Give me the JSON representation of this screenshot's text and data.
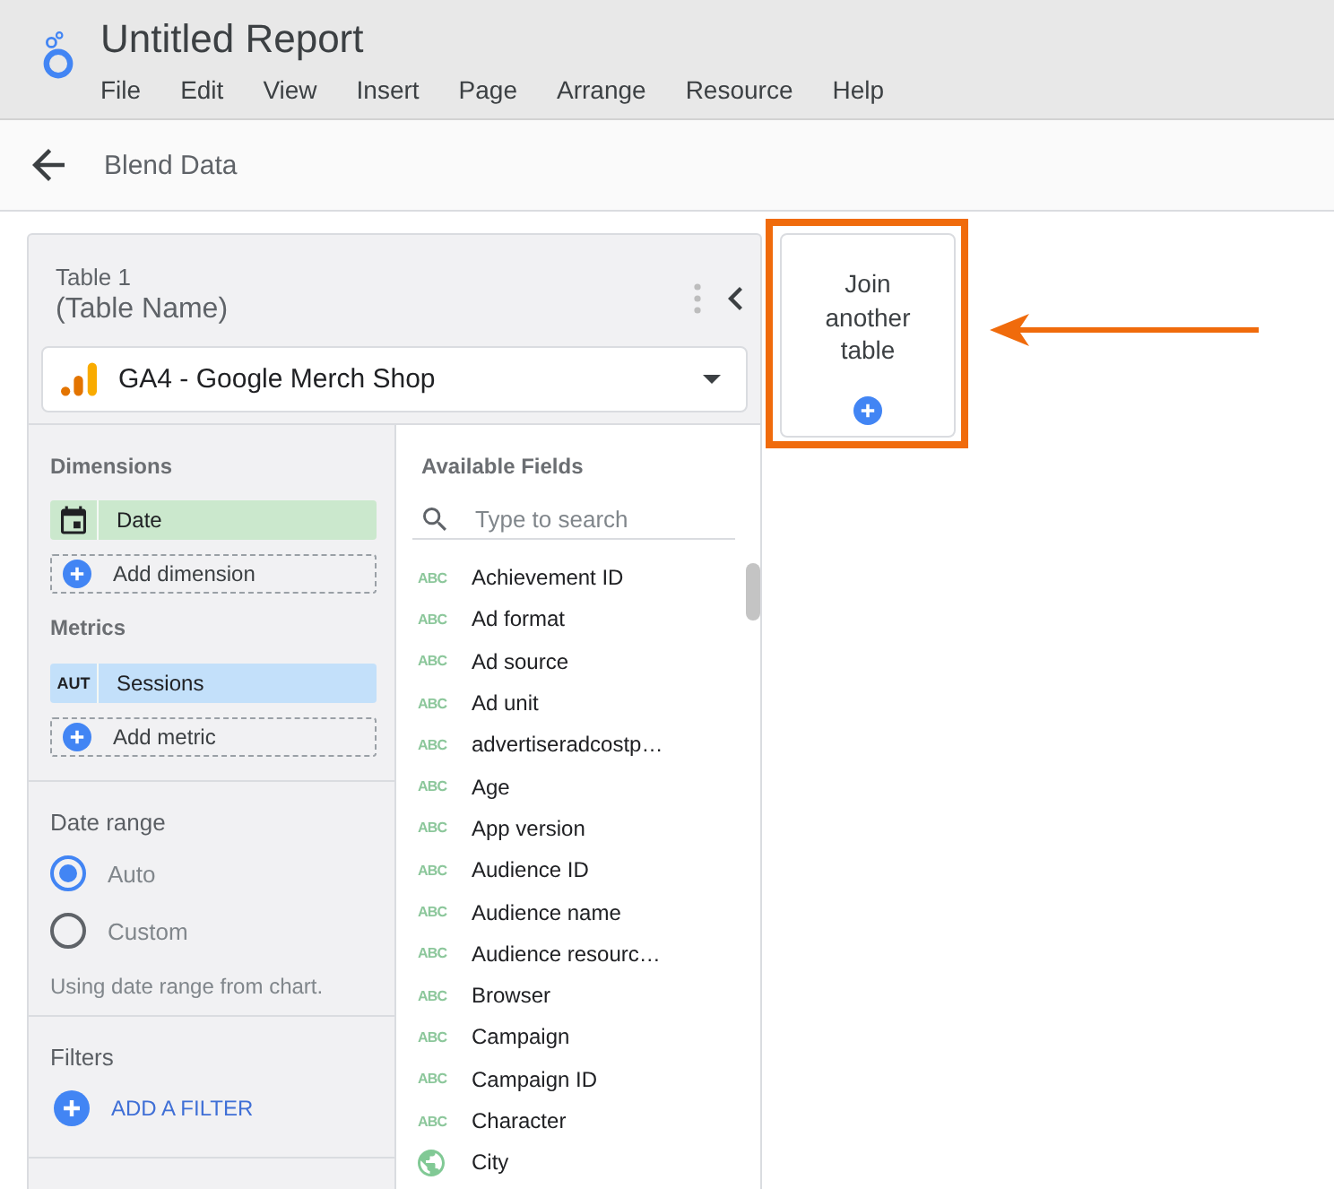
{
  "app": {
    "title": "Untitled Report",
    "menu": [
      "File",
      "Edit",
      "View",
      "Insert",
      "Page",
      "Arrange",
      "Resource",
      "Help"
    ]
  },
  "toolbar": {
    "title": "Blend Data"
  },
  "table_panel": {
    "label": "Table 1",
    "name": "(Table Name)",
    "data_source": "GA4 - Google Merch Shop",
    "dimensions": {
      "title": "Dimensions",
      "items": [
        {
          "label": "Date",
          "kind": "date"
        }
      ],
      "add_label": "Add dimension"
    },
    "metrics": {
      "title": "Metrics",
      "items": [
        {
          "label": "Sessions",
          "kind": "number",
          "badge": "AUT"
        }
      ],
      "add_label": "Add metric"
    },
    "date_range": {
      "title": "Date range",
      "options": [
        {
          "label": "Auto",
          "selected": true
        },
        {
          "label": "Custom",
          "selected": false
        }
      ],
      "note": "Using date range from chart."
    },
    "filters": {
      "title": "Filters",
      "add_label": "ADD A FILTER"
    },
    "available_fields": {
      "title": "Available Fields",
      "search": {
        "placeholder": "Type to search"
      },
      "fields": [
        {
          "label": "Achievement ID",
          "kind": "text",
          "badge": "ABC"
        },
        {
          "label": "Ad format",
          "kind": "text",
          "badge": "ABC"
        },
        {
          "label": "Ad source",
          "kind": "text",
          "badge": "ABC"
        },
        {
          "label": "Ad unit",
          "kind": "text",
          "badge": "ABC"
        },
        {
          "label": "advertiseradcostp…",
          "kind": "text",
          "badge": "ABC"
        },
        {
          "label": "Age",
          "kind": "text",
          "badge": "ABC"
        },
        {
          "label": "App version",
          "kind": "text",
          "badge": "ABC"
        },
        {
          "label": "Audience ID",
          "kind": "text",
          "badge": "ABC"
        },
        {
          "label": "Audience name",
          "kind": "text",
          "badge": "ABC"
        },
        {
          "label": "Audience resourc…",
          "kind": "text",
          "badge": "ABC"
        },
        {
          "label": "Browser",
          "kind": "text",
          "badge": "ABC"
        },
        {
          "label": "Campaign",
          "kind": "text",
          "badge": "ABC"
        },
        {
          "label": "Campaign ID",
          "kind": "text",
          "badge": "ABC"
        },
        {
          "label": "Character",
          "kind": "text",
          "badge": "ABC"
        },
        {
          "label": "City",
          "kind": "geo"
        }
      ]
    }
  },
  "join_card": {
    "label": "Join another table",
    "highlighted": true
  }
}
